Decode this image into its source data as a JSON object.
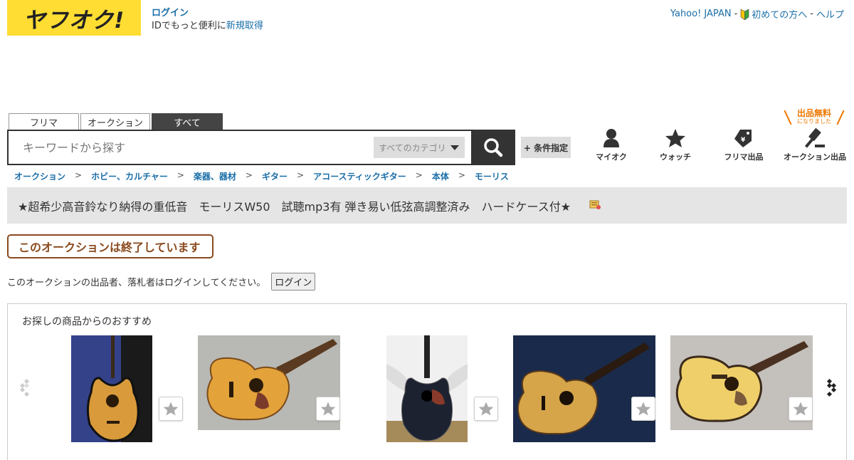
{
  "header": {
    "logo_text": "ヤフオク!",
    "login_label": "ログイン",
    "id_text": "IDでもっと便利に",
    "register_label": "新規取得",
    "yahoo_japan": "Yahoo! JAPAN",
    "beginner_label": "初めての方へ",
    "help_label": "ヘルプ",
    "separator": "-"
  },
  "search": {
    "tabs": [
      {
        "label": "フリマ",
        "active": false
      },
      {
        "label": "オークション",
        "active": false
      },
      {
        "label": "すべて",
        "active": true
      }
    ],
    "placeholder": "キーワードから探す",
    "category_label": "すべてのカテゴリ",
    "condition_label": "+ 条件指定"
  },
  "nav": {
    "myauc": "マイオク",
    "watch": "ウォッチ",
    "flea_listing": "フリマ出品",
    "auction_listing": "オークション出品",
    "free_badge_main": "出品無料",
    "free_badge_sub": "になりました"
  },
  "breadcrumb": [
    "オークション",
    "ホビー、カルチャー",
    "楽器、器材",
    "ギター",
    "アコースティックギター",
    "本体",
    "モーリス"
  ],
  "breadcrumb_separator": ">",
  "item": {
    "title": "★超希少高音鈴なり納得の重低音　モーリスW50　試聴mp3有 弾き易い低弦高調整済み　ハードケース付★"
  },
  "status": {
    "ended_label": "このオークションは終了しています",
    "login_notice": "このオークションの出品者、落札者はログインしてください。",
    "login_button": "ログイン"
  },
  "recommend": {
    "title": "お探しの商品からのおすすめ",
    "items": [
      {
        "image": "guitar-photo-1"
      },
      {
        "image": "guitar-photo-2"
      },
      {
        "image": "guitar-photo-3"
      },
      {
        "image": "guitar-photo-4"
      },
      {
        "image": "guitar-photo-5"
      }
    ]
  },
  "colors": {
    "brand_yellow": "#ffdd33",
    "link_blue": "#1a6ea8",
    "ended_brown": "#8a4a1e",
    "badge_orange": "#ee7700"
  }
}
